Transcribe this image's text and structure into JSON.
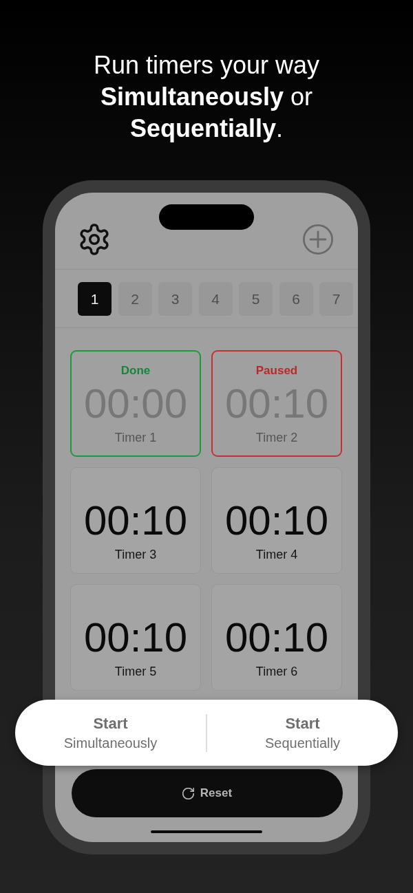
{
  "headline": {
    "lines": [
      "Run timers your way",
      "**Simultaneously** or",
      "**Sequentially**."
    ]
  },
  "phone": {
    "pages": [
      {
        "label": "1",
        "selected": true
      },
      {
        "label": "2",
        "selected": false
      },
      {
        "label": "3",
        "selected": false
      },
      {
        "label": "4",
        "selected": false
      },
      {
        "label": "5",
        "selected": false
      },
      {
        "label": "6",
        "selected": false
      },
      {
        "label": "7",
        "selected": false
      }
    ],
    "timers": [
      {
        "kind": "done",
        "status": "Done",
        "time": "00:00",
        "name": "Timer 1"
      },
      {
        "kind": "paused",
        "status": "Paused",
        "time": "00:10",
        "name": "Timer 2"
      },
      {
        "kind": "idle",
        "time": "00:10",
        "name": "Timer 3"
      },
      {
        "kind": "idle",
        "time": "00:10",
        "name": "Timer 4"
      },
      {
        "kind": "idle",
        "time": "00:10",
        "name": "Timer 5"
      },
      {
        "kind": "idle",
        "time": "00:10",
        "name": "Timer 6"
      }
    ],
    "reset_button": {
      "label": "Reset"
    }
  },
  "start_options": [
    {
      "title": "Start",
      "subtitle": "Simultaneously"
    },
    {
      "title": "Start",
      "subtitle": "Sequentially"
    }
  ]
}
